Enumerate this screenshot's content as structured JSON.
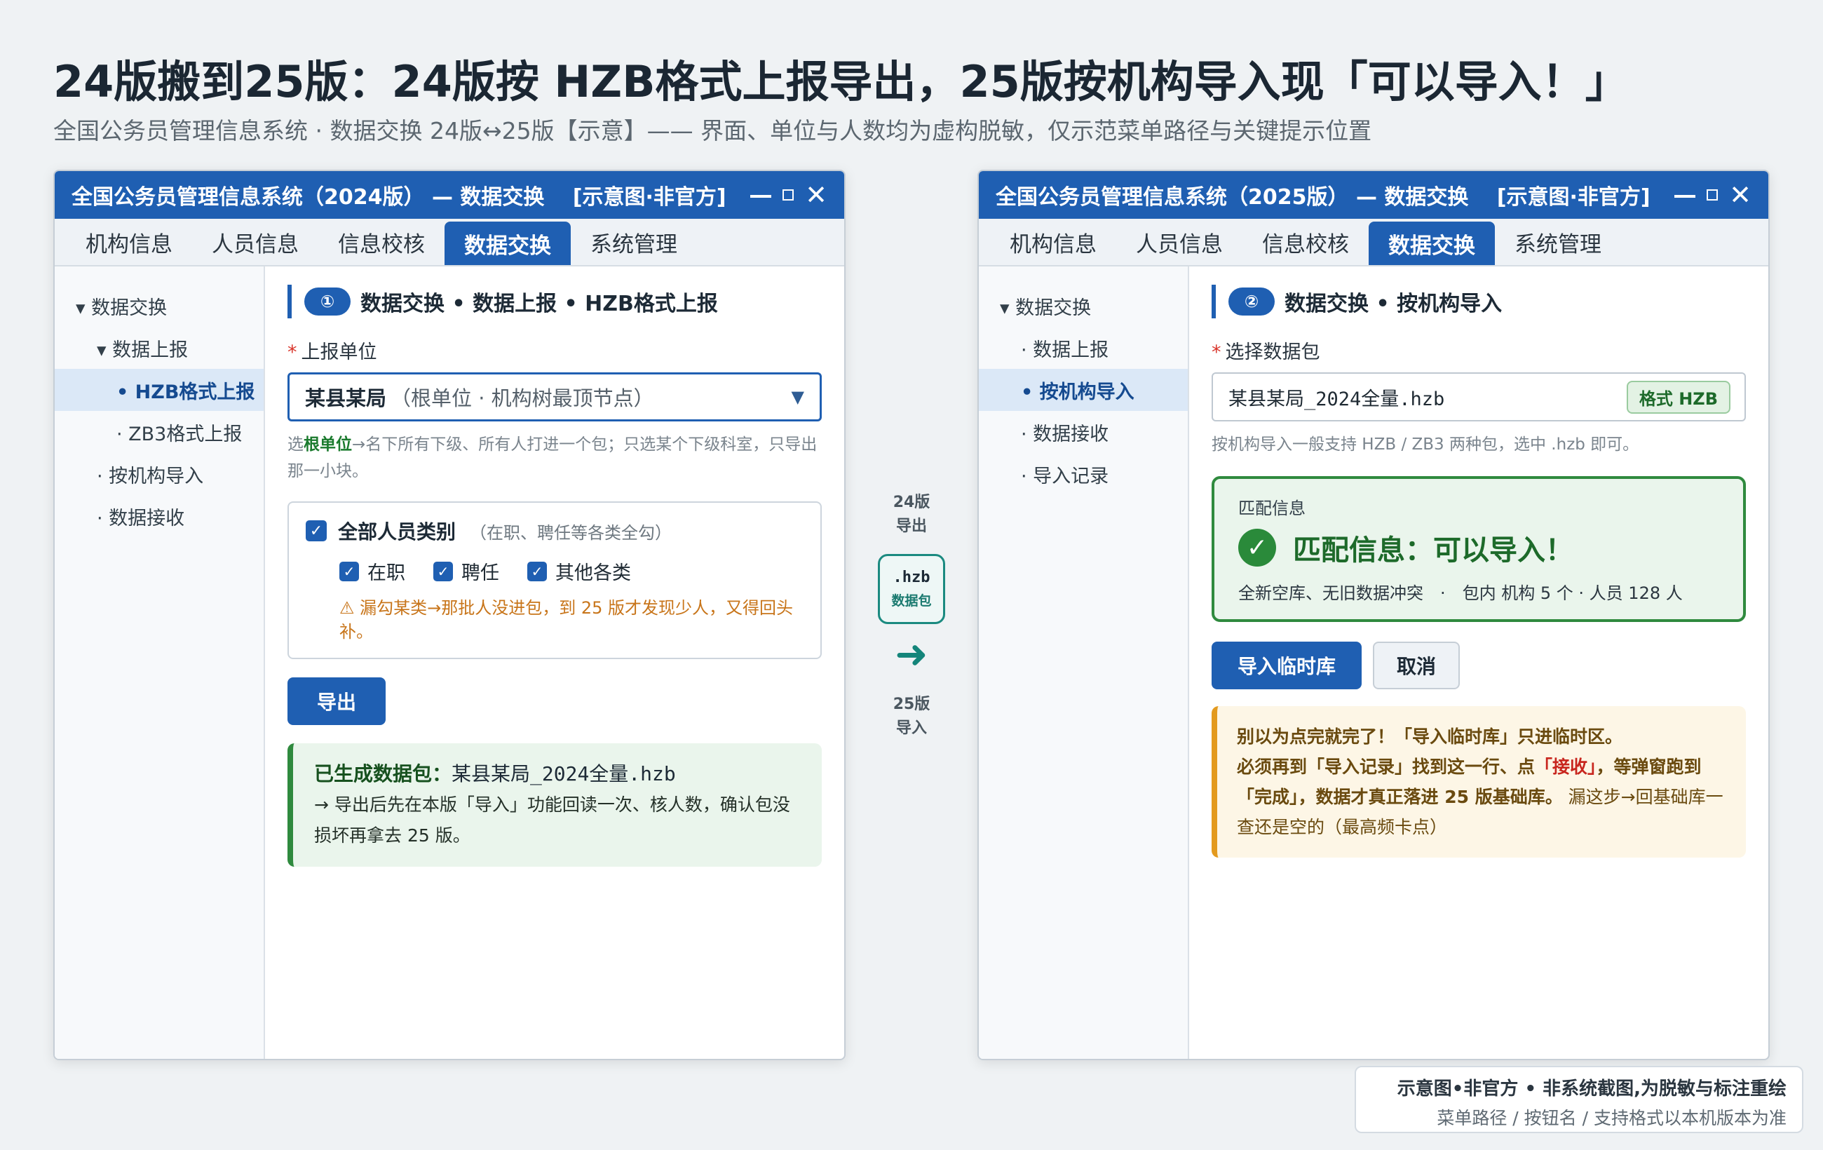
{
  "page": {
    "title": "24版搬到25版：24版按 HZB格式上报导出，25版按机构导入现「可以导入！」",
    "subtitle": "全国公务员管理信息系统 · 数据交换 24版↔25版【示意】—— 界面、单位与人数均为虚构脱敏，仅示范菜单路径与关键提示位置"
  },
  "tabs": [
    "机构信息",
    "人员信息",
    "信息校核",
    "数据交换",
    "系统管理"
  ],
  "left": {
    "window_title": "全国公务员管理信息系统（2024版） — 数据交换　 [示意图·非官方]",
    "sidebar": [
      "▾ 数据交换",
      "▾ 数据上报",
      "• HZB格式上报",
      "· ZB3格式上报",
      "· 按机构导入",
      "· 数据接收"
    ],
    "step_num": "①",
    "step_title": "数据交换 • 数据上报 • HZB格式上报",
    "unit_label": "上报单位",
    "unit_value": "某县某局",
    "unit_hint": "（根单位 · 机构树最顶节点）",
    "help_prefix": "选",
    "help_strong": "根单位",
    "help_rest": "→名下所有下级、所有人打进一个包；只选某个下级科室，只导出那一小块。",
    "check_all": "全部人员类别",
    "check_all_note": "（在职、聘任等各类全勾）",
    "check_items": [
      "在职",
      "聘任",
      "其他各类"
    ],
    "check_mark": "✓",
    "warning": "⚠ 漏勾某类→那批人没进包，到 25 版才发现少人，又得回头补。",
    "export_button": "导出",
    "result_title": "已生成数据包：",
    "result_file": "某县某局_2024全量.hzb",
    "result_text": "→ 导出后先在本版「导入」功能回读一次、核人数，确认包没损坏再拿去 25 版。"
  },
  "right": {
    "window_title": "全国公务员管理信息系统（2025版） — 数据交换　 [示意图·非官方]",
    "sidebar": [
      "▾ 数据交换",
      "· 数据上报",
      "• 按机构导入",
      "· 数据接收",
      "· 导入记录"
    ],
    "step_num": "②",
    "step_title": "数据交换 • 按机构导入",
    "file_label": "选择数据包",
    "file_value": "某县某局_2024全量.hzb",
    "format_badge": "格式 HZB",
    "help": "按机构导入一般支持 HZB / ZB3 两种包，选中 .hzb 即可。",
    "match_label": "匹配信息",
    "match_check": "✓",
    "match_text": "匹配信息：可以导入！",
    "match_detail": "全新空库、无旧数据冲突　·　包内 机构 5 个 · 人员 128 人",
    "import_button": "导入临时库",
    "cancel_button": "取消",
    "warn_line1": "别以为点完就完了！「导入临时库」只进临时区。",
    "warn_line2_a": "必须再到「导入记录」找到这一行、点",
    "warn_line2_red": "「接收」",
    "warn_line2_b": "，等弹窗跑到「完成」，数据才真正落进 25 版基础库。",
    "warn_line2_c": "漏这步→回基础库一查还是空的（最高频卡点）"
  },
  "flow": {
    "top_label_1": "24版",
    "top_label_2": "导出",
    "pkg_ext": ".hzb",
    "pkg_label": "数据包",
    "arrow": "➜",
    "bottom_label_1": "25版",
    "bottom_label_2": "导入"
  },
  "footer": {
    "line1": "示意图•非官方 • 非系统截图,为脱敏与标注重绘",
    "line2": "菜单路径 / 按钮名 / 支持格式以本机版本为准"
  }
}
